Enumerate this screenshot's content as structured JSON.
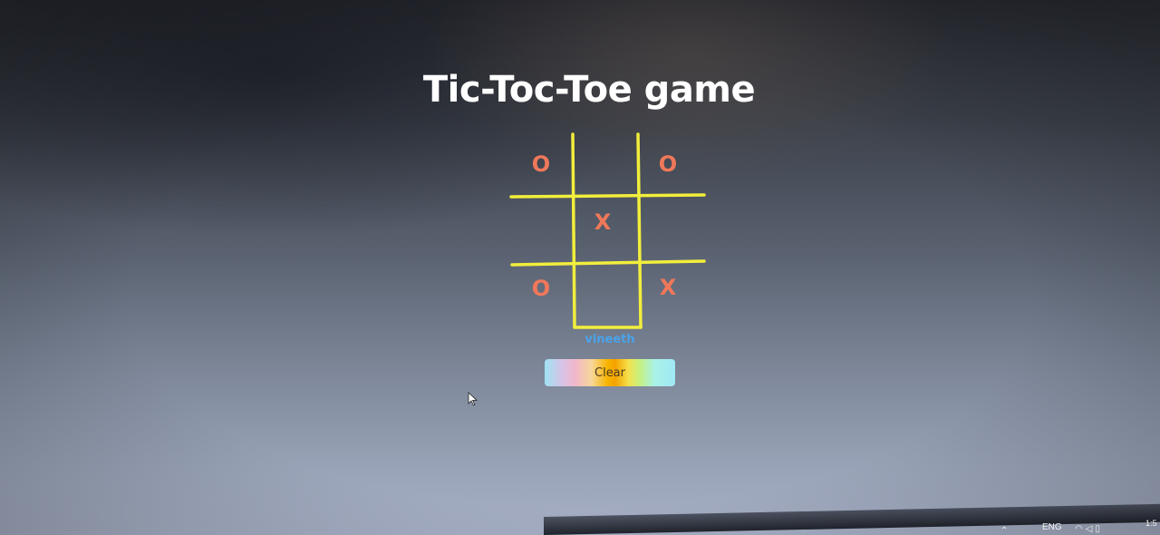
{
  "page": {
    "title": "Tic-Toc-Toe game"
  },
  "board": {
    "cells": [
      "O",
      "",
      "O",
      "",
      "X",
      "",
      "O",
      "",
      "X"
    ],
    "line_color": "#f2ee3c",
    "mark_color": "#f0785a"
  },
  "player": {
    "name": "vineeth"
  },
  "controls": {
    "clear_label": "Clear"
  },
  "taskbar": {
    "language": "ENG",
    "icons": [
      "show-hidden-icons-icon",
      "refresh-icon",
      "wifi-icon",
      "volume-icon",
      "battery-icon"
    ],
    "time": "1:5"
  }
}
